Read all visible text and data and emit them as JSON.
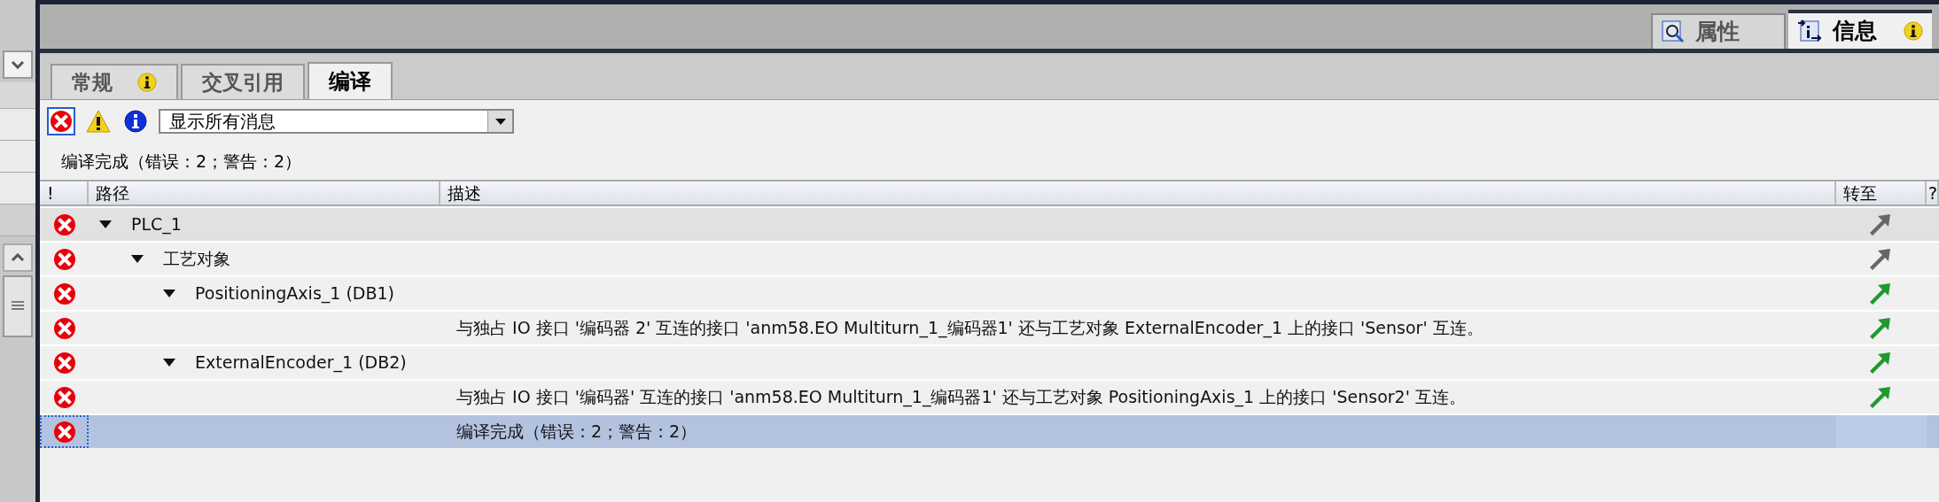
{
  "side_tabs": [
    {
      "label": "属性",
      "selected": false,
      "badge": false
    },
    {
      "label": "信息",
      "selected": true,
      "badge": true
    }
  ],
  "tabs": [
    {
      "label": "常规",
      "selected": false,
      "badge": true
    },
    {
      "label": "交叉引用",
      "selected": false,
      "badge": false
    },
    {
      "label": "编译",
      "selected": true,
      "badge": false
    }
  ],
  "filters": [
    {
      "kind": "error",
      "selected": true
    },
    {
      "kind": "warning",
      "selected": false
    },
    {
      "kind": "info",
      "selected": false
    }
  ],
  "filter_select": {
    "value": "显示所有消息"
  },
  "summary": "编译完成（错误：2；警告：2）",
  "table": {
    "columns": [
      "!",
      "路径",
      "描述",
      "转至",
      "?"
    ],
    "rows": [
      {
        "kind": "error",
        "path": "PLC_1",
        "expanded": true,
        "color": "#666666",
        "selected": false,
        "children": [
          {
            "kind": "error",
            "path": "工艺对象",
            "expanded": true,
            "color": "#666666",
            "selected": false,
            "children": [
              {
                "kind": "error",
                "path": "PositioningAxis_1 (DB1)",
                "expanded": true,
                "color": "#1f9a2e",
                "selected": false,
                "children": [
                  {
                    "kind": "error",
                    "description": "与独占 IO 接口 '编码器 2' 互连的接口 'anm58.EO Multiturn_1_编码器1' 还与工艺对象 ExternalEncoder_1 上的接口 'Sensor' 互连。",
                    "color": "#1f9a2e",
                    "selected": false
                  }
                ]
              },
              {
                "kind": "error",
                "path": "ExternalEncoder_1 (DB2)",
                "expanded": true,
                "color": "#1f9a2e",
                "selected": false,
                "children": [
                  {
                    "kind": "error",
                    "description": "与独占 IO 接口 '编码器' 互连的接口 'anm58.EO Multiturn_1_编码器1' 还与工艺对象 PositioningAxis_1 上的接口 'Sensor2' 互连。",
                    "color": "#1f9a2e",
                    "selected": false
                  }
                ]
              }
            ]
          }
        ]
      },
      {
        "kind": "error",
        "description": "编译完成（错误：2；警告：2）",
        "selected": true
      }
    ]
  }
}
